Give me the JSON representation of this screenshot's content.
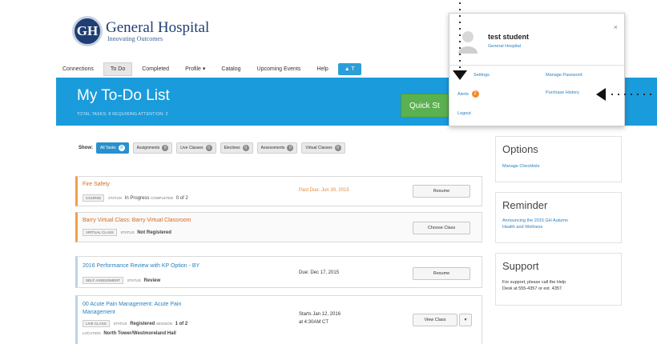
{
  "logo": {
    "mark": "GH",
    "name": "General Hospital",
    "tagline": "Innovating Outcomes"
  },
  "nav": {
    "items": [
      "Connections",
      "To Do",
      "Completed",
      "Profile ▾",
      "Catalog",
      "Upcoming Events",
      "Help"
    ],
    "active_index": 1,
    "button_label": "▲ T"
  },
  "banner": {
    "title": "My To-Do List",
    "subtitle": "TOTAL TASKS: 8   REQUIRING ATTENTION: 2",
    "quickstart_label": "Quick St"
  },
  "filters": {
    "show_label": "Show:",
    "chips": [
      {
        "label": "All Tasks",
        "count": "8",
        "selected": true
      },
      {
        "label": "Assignments",
        "count": "0",
        "selected": false
      },
      {
        "label": "Live Classes",
        "count": "0",
        "selected": false
      },
      {
        "label": "Electives",
        "count": "0",
        "selected": false
      },
      {
        "label": "Assessments",
        "count": "0",
        "selected": false
      },
      {
        "label": "Virtual Classes",
        "count": "0",
        "selected": false
      }
    ]
  },
  "tasks": [
    {
      "title": "Fire Safety",
      "tag": "COURSE",
      "status_label": "STATUS",
      "status": "In Progress",
      "extra_label": "COMPLETED",
      "extra": "0 of 2",
      "due": "Past Due: Jun 30, 2015",
      "action": "Resume"
    },
    {
      "title": "Barry Virtual Class: Barry Virtual Classroom",
      "tag": "VIRTUAL CLASS",
      "status_label": "STATUS",
      "status": "Not Registered",
      "action": "Choose Class"
    },
    {
      "title": "2016 Performance Review with KP Option - BY",
      "tag": "SELF ASSESSMENT",
      "status_label": "STATUS",
      "status": "Review",
      "due": "Due: Dec 17, 2015",
      "action": "Resume"
    },
    {
      "title_line1": "00 Acute Pain Management: Acute Pain",
      "title_line2": "Management",
      "tag": "LIVE CLASS",
      "status_label": "STATUS",
      "status": "Registered",
      "session_label": "SESSION",
      "session": "1 of 2",
      "location_label": "LOCATION",
      "location": "North Tower/Westmoreland Hall",
      "due_line1": "Starts Jan 12, 2016",
      "due_line2": "at 4:30AM CT",
      "action": "View Class",
      "action_caret": "▾"
    }
  ],
  "sidebar": {
    "options": {
      "title": "Options",
      "link": "Manage Checklists"
    },
    "reminder": {
      "title": "Reminder",
      "text_line1": "Announcing the 2015 GH Autumn",
      "text_line2": "Health and Wellness"
    },
    "support": {
      "title": "Support",
      "text_line1": "For support, please call the Help",
      "text_line2": "Desk at 555-4357 or ext. 4357."
    }
  },
  "popup": {
    "name": "test student",
    "org": "General Hospital",
    "close": "×",
    "links": {
      "settings": "Settings",
      "alerts": "Alerts",
      "alerts_count": "2",
      "logout": "Logout",
      "manage_password": "Manage Password",
      "purchase_history": "Purchase History"
    }
  },
  "colors": {
    "brand": "#1f3f73",
    "banner": "#1a9bdc",
    "quickstart": "#5bb04f",
    "alert": "#f08a2c",
    "link": "#2a80c0"
  }
}
